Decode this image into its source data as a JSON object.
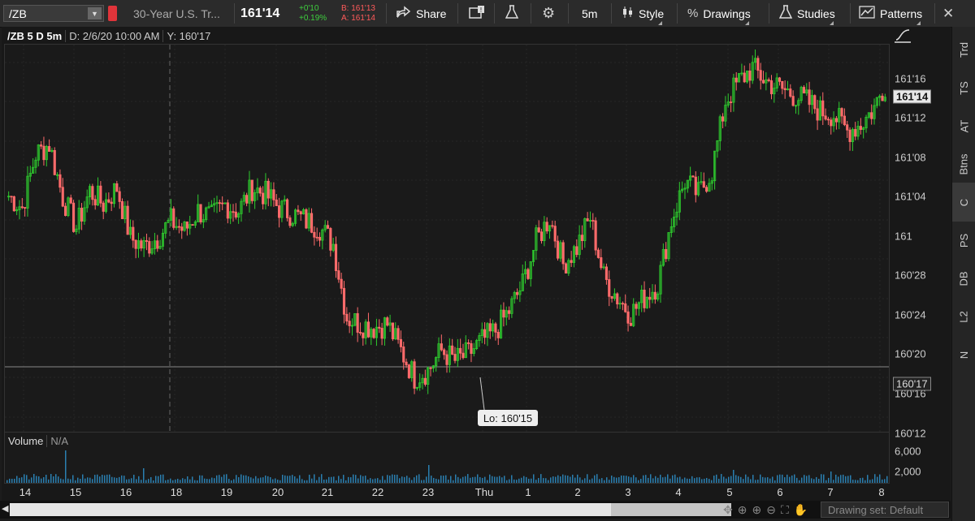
{
  "toolbar": {
    "symbol": "/ZB",
    "description": "30-Year U.S. Tr...",
    "last": "161'14",
    "net_change": "+0'10",
    "pct_change": "+0.19%",
    "bid": "B: 161'13",
    "ask": "A: 161'14",
    "share": "Share",
    "timeframe": "5m",
    "style": "Style",
    "drawings": "Drawings",
    "studies": "Studies",
    "patterns": "Patterns"
  },
  "chart_header": {
    "symbol_tf": "/ZB 5 D 5m",
    "date": "D: 2/6/20 10:00 AM",
    "y": "Y: 160'17"
  },
  "y_axis": {
    "ticks": [
      "161'16",
      "161'12",
      "161'08",
      "161'04",
      "161",
      "160'28",
      "160'24",
      "160'20",
      "160'16",
      "160'12"
    ],
    "last_label": "161'14",
    "cursor_label": "160'17"
  },
  "annotation": "Lo: 160'15",
  "volume": {
    "label": "Volume",
    "value": "N/A",
    "ticks": [
      "6,000",
      "2,000"
    ]
  },
  "x_axis": [
    "14",
    "15",
    "16",
    "18",
    "19",
    "20",
    "21",
    "22",
    "23",
    "Thu",
    "1",
    "2",
    "3",
    "4",
    "5",
    "6",
    "7",
    "8"
  ],
  "scroll": {
    "drawing_set": "Drawing set: Default"
  },
  "side_tabs": [
    "Trd",
    "TS",
    "AT",
    "Btns",
    "C",
    "PS",
    "DB",
    "L2",
    "N"
  ],
  "colors": {
    "up": "#2ecc2e",
    "down": "#ff6b6b",
    "background": "#1a1a1a",
    "grid": "#2a2a2a",
    "volume": "#2a7fb0"
  },
  "chart_data": {
    "type": "candlestick",
    "y_unit": "price (1/32nds)",
    "ylim": [
      "160'10",
      "161'19"
    ],
    "low_marker": "160'15",
    "series": [
      {
        "name": "/ZB 5m",
        "close_path": [
          161.125,
          161.09,
          161.25,
          161.28,
          161.12,
          161.03,
          161.14,
          161.1,
          161.15,
          161.0,
          160.97,
          161.0,
          161.05,
          161.02,
          161.08,
          161.06,
          161.1,
          161.08,
          161.15,
          161.13,
          161.09,
          161.07,
          161.05,
          161.03,
          160.98,
          160.76,
          160.74,
          160.73,
          160.74,
          160.66,
          160.58,
          160.6,
          160.66,
          160.63,
          160.65,
          160.69,
          160.72,
          160.78,
          160.86,
          160.99,
          161.06,
          160.92,
          160.97,
          161.06,
          160.88,
          160.82,
          160.77,
          160.82,
          160.86,
          161.05,
          161.17,
          161.13,
          161.2,
          161.41,
          161.47,
          161.51,
          161.47,
          161.45,
          161.43,
          161.41,
          161.38,
          161.37,
          161.32,
          161.34,
          161.39,
          161.48
        ]
      }
    ]
  }
}
